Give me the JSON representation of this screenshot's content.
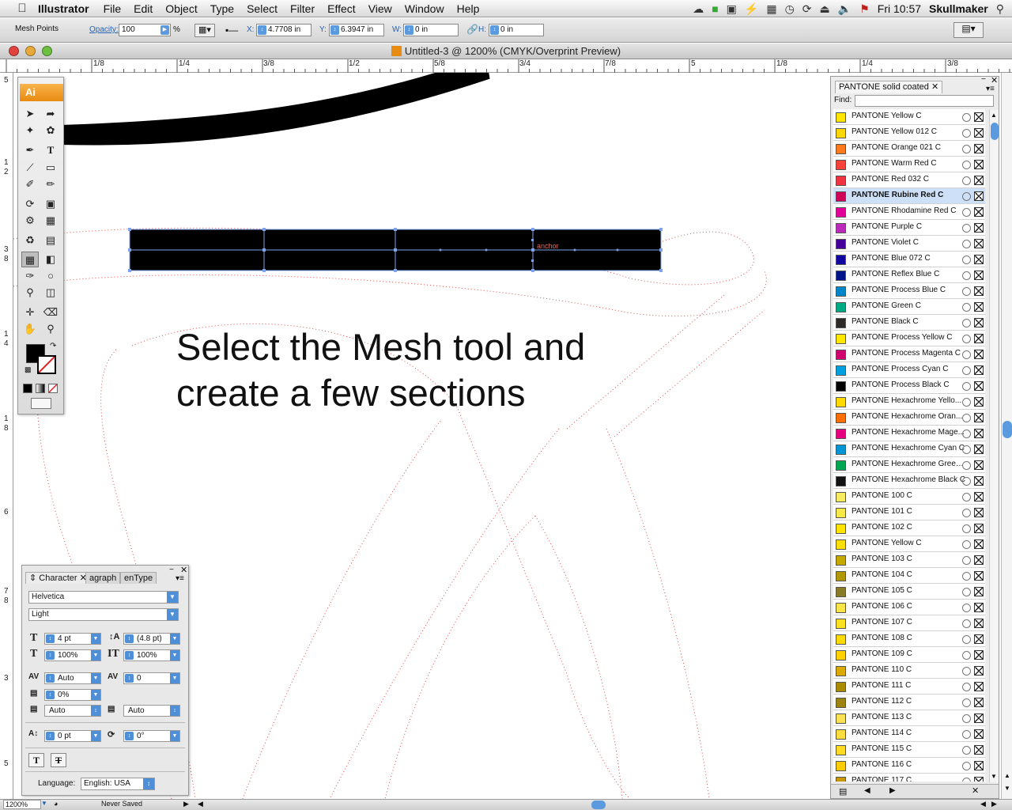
{
  "menubar": {
    "app_name": "Illustrator",
    "items": [
      "File",
      "Edit",
      "Object",
      "Type",
      "Select",
      "Filter",
      "Effect",
      "View",
      "Window",
      "Help"
    ],
    "clock": "Fri 10:57",
    "user": "Skullmaker"
  },
  "control_bar": {
    "mode_label": "Mesh Points",
    "opacity_label": "Opacity:",
    "opacity_value": "100",
    "percent": "%",
    "x_label": "X:",
    "x_value": "4.7708 in",
    "y_label": "Y:",
    "y_value": "6.3947 in",
    "w_label": "W:",
    "w_value": "0 in",
    "h_label": "H:",
    "h_value": "0 in"
  },
  "document": {
    "title": "Untitled-3 @ 1200% (CMYK/Overprint Preview)"
  },
  "ruler": {
    "h_labels": [
      "1/8",
      "1/4",
      "3/8",
      "1/2",
      "5/8",
      "3/4",
      "7/8",
      "5",
      "1/8",
      "1/4",
      "3/8"
    ],
    "v_labels": [
      "5",
      "1",
      "2",
      "3",
      "8",
      "1",
      "4",
      "1",
      "8",
      "6",
      "7",
      "8",
      "3",
      "5"
    ]
  },
  "canvas": {
    "instruction_line1": "Select the Mesh tool and",
    "instruction_line2": "create a few sections",
    "anchor_label": "anchor"
  },
  "tools_panel": {
    "logo": "Ai"
  },
  "character_panel": {
    "tab_character": "Character",
    "tab_paragraph": "agraph",
    "tab_opentype": "enType",
    "font_family": "Helvetica",
    "font_style": "Light",
    "font_size": "4 pt",
    "leading": "(4.8 pt)",
    "horizontal_scale": "100%",
    "vertical_scale": "100%",
    "kerning": "Auto",
    "tracking": "0",
    "tsume": "0%",
    "aki_left": "Auto",
    "aki_right": "Auto",
    "baseline_shift": "0 pt",
    "rotation": "0°",
    "language_label": "Language:",
    "language_value": "English: USA"
  },
  "swatches_panel": {
    "tab": "PANTONE solid coated",
    "find_label": "Find:",
    "find_value": "",
    "swatches": [
      {
        "name": "PANTONE Yellow C",
        "color": "#FFE600"
      },
      {
        "name": "PANTONE Yellow 012 C",
        "color": "#FFD700"
      },
      {
        "name": "PANTONE Orange 021 C",
        "color": "#FF7A1A"
      },
      {
        "name": "PANTONE Warm Red C",
        "color": "#F9423A"
      },
      {
        "name": "PANTONE Red 032 C",
        "color": "#EF3340"
      },
      {
        "name": "PANTONE Rubine Red C",
        "color": "#CE0058",
        "selected": true
      },
      {
        "name": "PANTONE Rhodamine Red C",
        "color": "#E10098"
      },
      {
        "name": "PANTONE Purple C",
        "color": "#BB29BB"
      },
      {
        "name": "PANTONE Violet C",
        "color": "#440099"
      },
      {
        "name": "PANTONE Blue 072 C",
        "color": "#10069F"
      },
      {
        "name": "PANTONE Reflex Blue C",
        "color": "#001489"
      },
      {
        "name": "PANTONE Process Blue C",
        "color": "#0085CA"
      },
      {
        "name": "PANTONE Green C",
        "color": "#00AB84"
      },
      {
        "name": "PANTONE Black C",
        "color": "#2D2926"
      },
      {
        "name": "PANTONE Process Yellow C",
        "color": "#FFE800"
      },
      {
        "name": "PANTONE Process Magenta C",
        "color": "#D0006F"
      },
      {
        "name": "PANTONE Process Cyan C",
        "color": "#009FDF"
      },
      {
        "name": "PANTONE Process Black C",
        "color": "#000000"
      },
      {
        "name": "PANTONE Hexachrome Yello...",
        "color": "#FFDA00"
      },
      {
        "name": "PANTONE Hexachrome Oran...",
        "color": "#FF6F00"
      },
      {
        "name": "PANTONE Hexachrome Mage...",
        "color": "#E6007E"
      },
      {
        "name": "PANTONE Hexachrome Cyan C",
        "color": "#0096D6"
      },
      {
        "name": "PANTONE Hexachrome Green C",
        "color": "#00A651"
      },
      {
        "name": "PANTONE Hexachrome Black C",
        "color": "#111111"
      },
      {
        "name": "PANTONE 100 C",
        "color": "#F6EB61"
      },
      {
        "name": "PANTONE 101 C",
        "color": "#F7EA48"
      },
      {
        "name": "PANTONE 102 C",
        "color": "#FCE300"
      },
      {
        "name": "PANTONE Yellow C",
        "color": "#FEDD00"
      },
      {
        "name": "PANTONE 103 C",
        "color": "#C5A900"
      },
      {
        "name": "PANTONE 104 C",
        "color": "#AF9800"
      },
      {
        "name": "PANTONE 105 C",
        "color": "#897A27"
      },
      {
        "name": "PANTONE 106 C",
        "color": "#F9E547"
      },
      {
        "name": "PANTONE 107 C",
        "color": "#FBE122"
      },
      {
        "name": "PANTONE 108 C",
        "color": "#FEDB00"
      },
      {
        "name": "PANTONE 109 C",
        "color": "#FFD100"
      },
      {
        "name": "PANTONE 110 C",
        "color": "#DAAA00"
      },
      {
        "name": "PANTONE 111 C",
        "color": "#AA8A00"
      },
      {
        "name": "PANTONE 112 C",
        "color": "#9C8412"
      },
      {
        "name": "PANTONE 113 C",
        "color": "#FAE053"
      },
      {
        "name": "PANTONE 114 C",
        "color": "#FBDD40"
      },
      {
        "name": "PANTONE 115 C",
        "color": "#FDDA24"
      },
      {
        "name": "PANTONE 116 C",
        "color": "#FFCD00"
      },
      {
        "name": "PANTONE 117 C",
        "color": "#C99700"
      }
    ]
  },
  "status_bar": {
    "zoom": "1200%",
    "save_state": "Never Saved"
  }
}
